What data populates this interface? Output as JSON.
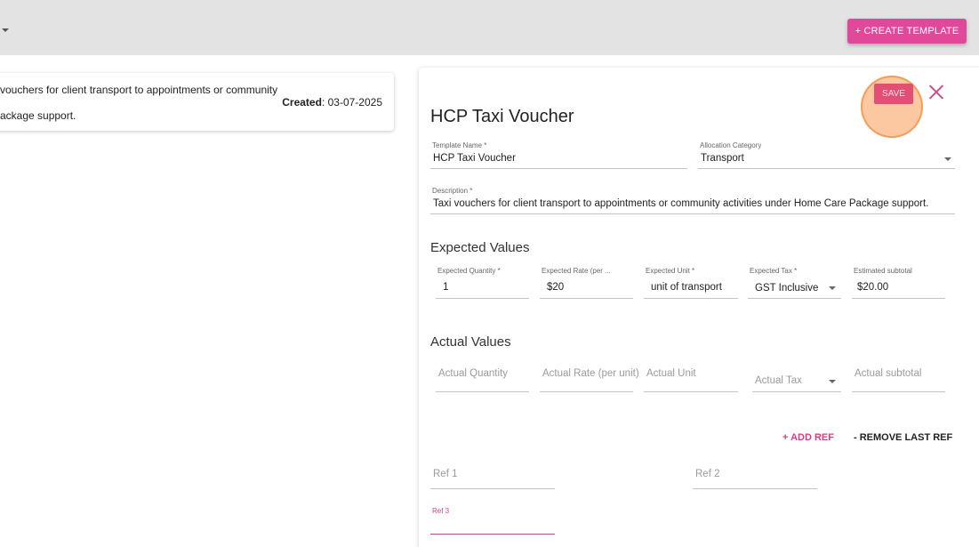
{
  "header": {
    "create_template_label": "+ CREATE TEMPLATE"
  },
  "left_card": {
    "description_line1": "vouchers for client transport to appointments or community",
    "created_label": "Created",
    "created_date": ": 03-07-2025",
    "description_line2": "ackage support."
  },
  "editor": {
    "title": "HCP Taxi Voucher",
    "save_label": "SAVE",
    "template_name": {
      "label": "Template Name *",
      "value": "HCP Taxi Voucher"
    },
    "allocation_category": {
      "label": "Allocation Category",
      "value": "Transport"
    },
    "description": {
      "label": "Description *",
      "value": "Taxi vouchers for client transport to appointments or community activities under Home Care Package support."
    },
    "expected_values": {
      "title": "Expected Values",
      "quantity": {
        "label": "Expected Quantity *",
        "value": "1"
      },
      "rate": {
        "label": "Expected Rate (per ...",
        "value": "$20"
      },
      "unit": {
        "label": "Expected Unit *",
        "value": "unit of transport"
      },
      "tax": {
        "label": "Expected Tax *",
        "value": "GST Inclusive"
      },
      "subtotal": {
        "label": "Estimated subtotal",
        "value": "$20.00"
      }
    },
    "actual_values": {
      "title": "Actual Values",
      "quantity_placeholder": "Actual Quantity",
      "rate_placeholder": "Actual Rate (per unit)",
      "unit_placeholder": "Actual Unit",
      "tax_placeholder": "Actual Tax",
      "subtotal_placeholder": "Actual subtotal"
    },
    "add_ref_label": "+ ADD REF",
    "remove_ref_label": "- REMOVE LAST REF",
    "refs": [
      {
        "placeholder": "Ref 1"
      },
      {
        "placeholder": "Ref 2"
      },
      {
        "label": "Ref 3"
      }
    ]
  },
  "colors": {
    "accent": "#e2489a",
    "save": "#e34e75",
    "highlight": "#f5a462"
  }
}
